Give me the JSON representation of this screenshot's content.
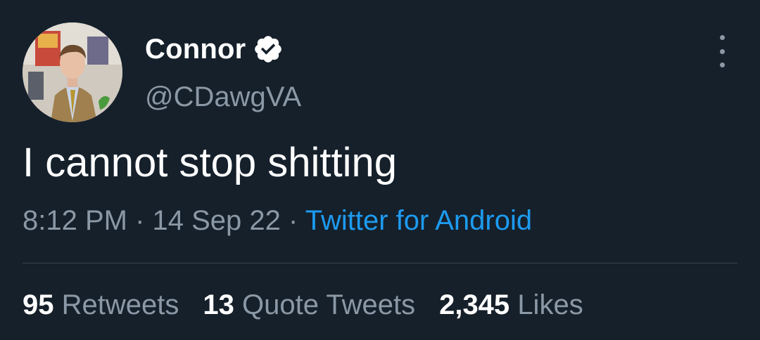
{
  "author": {
    "display_name": "Connor",
    "handle": "@CDawgVA",
    "verified_icon": "verified-badge-icon"
  },
  "tweet": {
    "text": "I cannot stop shitting"
  },
  "meta": {
    "time": "8:12 PM",
    "separator": " · ",
    "date": "14 Sep 22",
    "source": "Twitter for Android"
  },
  "stats": {
    "retweets_count": "95",
    "retweets_label": "Retweets",
    "quotes_count": "13",
    "quotes_label": "Quote Tweets",
    "likes_count": "2,345",
    "likes_label": "Likes"
  },
  "colors": {
    "background": "#15202b",
    "secondary_text": "#8b98a5",
    "link": "#1d9bf0",
    "divider": "#38444d"
  }
}
